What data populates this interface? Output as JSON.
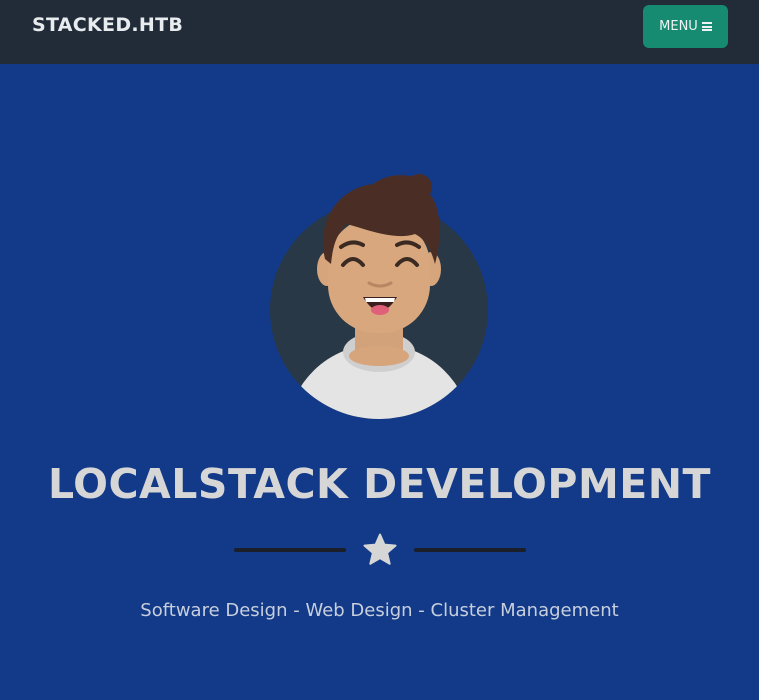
{
  "navbar": {
    "brand": "STACKED.HTB",
    "menu_label": "MENU",
    "menu_icon": "bars-icon"
  },
  "masthead": {
    "avatar_icon": "avatar-illustration",
    "title": "LOCALSTACK DEVELOPMENT",
    "divider_icon": "star-icon",
    "subtitle": "Software Design - Web Design - Cluster Management"
  },
  "colors": {
    "navbar_bg": "#212c38",
    "masthead_bg": "#123a89",
    "menu_button": "#178b72",
    "title_text": "#d6d6d6"
  }
}
